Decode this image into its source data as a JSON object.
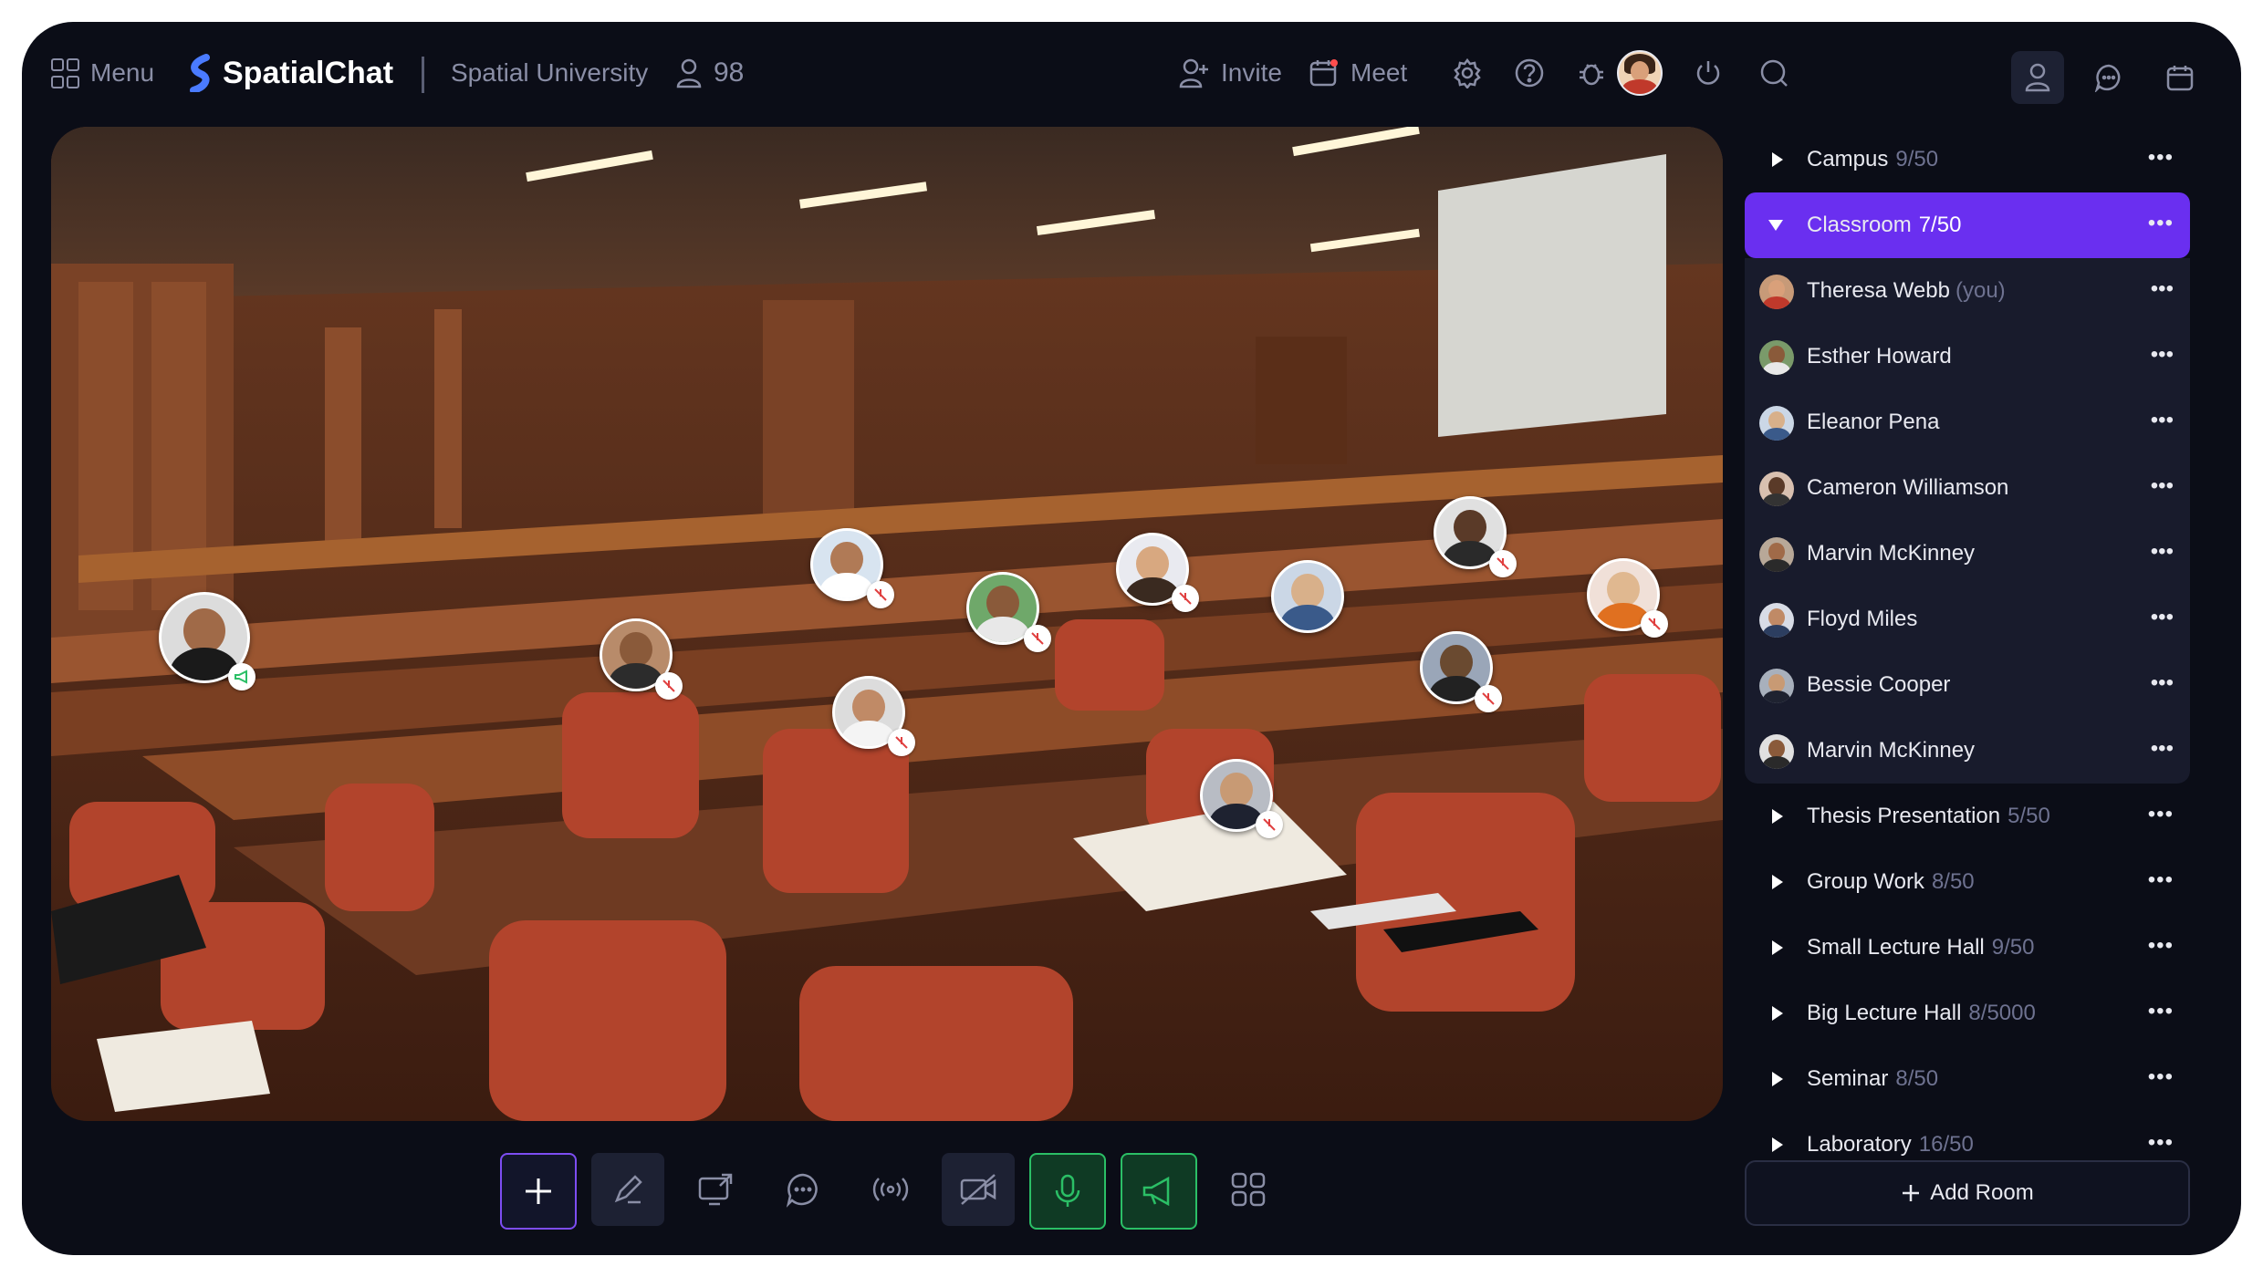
{
  "topbar": {
    "menu_label": "Menu",
    "brand": "SpatialChat",
    "space_name": "Spatial University",
    "participants_count": "98",
    "invite_label": "Invite",
    "meet_label": "Meet",
    "icons": [
      "settings-icon",
      "help-icon",
      "bug-icon",
      "power-icon",
      "search-icon"
    ],
    "right_tabs": [
      "people-tab",
      "chat-tab",
      "calendar-tab"
    ]
  },
  "rooms": [
    {
      "name": "Campus",
      "count": "9/50",
      "expanded": false
    },
    {
      "name": "Classroom",
      "count": "7/50",
      "expanded": true,
      "active": true
    },
    {
      "name": "Thesis Presentation",
      "count": "5/50"
    },
    {
      "name": "Group Work",
      "count": "8/50"
    },
    {
      "name": "Small Lecture Hall",
      "count": "9/50"
    },
    {
      "name": "Big Lecture Hall",
      "count": "8/5000"
    },
    {
      "name": "Seminar",
      "count": "8/50"
    },
    {
      "name": "Laboratory",
      "count": "16/50"
    }
  ],
  "members": [
    {
      "name": "Theresa Webb",
      "tag": "(you)"
    },
    {
      "name": "Esther Howard",
      "tag": ""
    },
    {
      "name": "Eleanor Pena",
      "tag": ""
    },
    {
      "name": "Cameron Williamson",
      "tag": ""
    },
    {
      "name": "Marvin McKinney",
      "tag": ""
    },
    {
      "name": "Floyd Miles",
      "tag": ""
    },
    {
      "name": "Bessie Cooper",
      "tag": ""
    },
    {
      "name": "Marvin McKinney",
      "tag": ""
    }
  ],
  "dots": "•••",
  "add_room_label": "Add Room",
  "toolbar": [
    "add-button",
    "draw-button",
    "screen-share-button",
    "chat-button",
    "broadcast-button",
    "camera-off-button",
    "mic-button",
    "megaphone-button",
    "apps-button"
  ],
  "colors": {
    "accent": "#6a2ff0",
    "bg": "#0b0d17",
    "green": "#2bbf66",
    "muted": "#6e7290"
  }
}
